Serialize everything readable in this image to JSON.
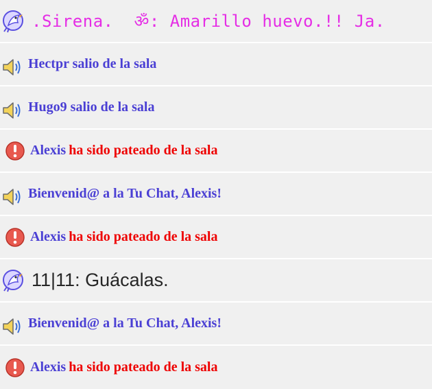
{
  "colors": {
    "system_text": "#4a3fd4",
    "kick_text": "#ee0000",
    "magenta_message": "#e52ee5",
    "dark_message": "#262626",
    "row_background": "#f0f0f0",
    "row_divider": "#ffffff"
  },
  "messages": [
    {
      "type": "user",
      "icon": "bird-icon",
      "text": ".Sirena.  ॐ: Amarillo huevo.!! Ja."
    },
    {
      "type": "system",
      "icon": "speaker-icon",
      "text": "Hectpr salio de la sala"
    },
    {
      "type": "system",
      "icon": "speaker-icon",
      "text": "Hugo9 salio de la sala"
    },
    {
      "type": "kick",
      "icon": "alert-icon",
      "name": "Alexis",
      "text": "ha sido pateado de la sala"
    },
    {
      "type": "system",
      "icon": "speaker-icon",
      "text": "Bienvenid@ a la Tu Chat, Alexis!"
    },
    {
      "type": "kick",
      "icon": "alert-icon",
      "name": "Alexis",
      "text": "ha sido pateado de la sala"
    },
    {
      "type": "user",
      "icon": "bird-icon",
      "text": "11|11: Guácalas."
    },
    {
      "type": "system",
      "icon": "speaker-icon",
      "text": "Bienvenid@ a la Tu Chat, Alexis!"
    },
    {
      "type": "kick",
      "icon": "alert-icon",
      "name": "Alexis",
      "text": "ha sido pateado de la sala"
    }
  ]
}
